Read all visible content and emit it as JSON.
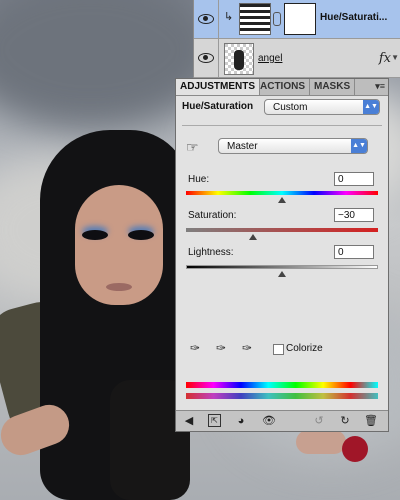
{
  "layers": {
    "rows": [
      {
        "name": "Hue/Saturati...",
        "type": "adjustment",
        "selected": true
      },
      {
        "name": "angel",
        "type": "pixel",
        "fx_label": "fx"
      }
    ]
  },
  "adjustments_panel": {
    "tabs": [
      {
        "label": "ADJUSTMENTS",
        "active": true
      },
      {
        "label": "ACTIONS",
        "active": false
      },
      {
        "label": "MASKS",
        "active": false
      }
    ],
    "title": "Hue/Saturation",
    "preset": "Custom",
    "channel": "Master",
    "hue": {
      "label": "Hue:",
      "value": "0",
      "slider_fraction": 0.5
    },
    "saturation": {
      "label": "Saturation:",
      "value": "−30",
      "slider_fraction": 0.35
    },
    "lightness": {
      "label": "Lightness:",
      "value": "0",
      "slider_fraction": 0.5
    },
    "colorize_label": "Colorize",
    "colorize_checked": false,
    "icons": [
      "eyedropper-icon",
      "eyedropper-plus-icon",
      "eyedropper-minus-icon"
    ],
    "bottom_icons": [
      "back-arrow-icon",
      "expand-icon",
      "clip-icon",
      "visibility-icon",
      "previous-state-icon",
      "reset-icon",
      "delete-icon"
    ]
  },
  "colors": {
    "panel_bg": "#e2e2e2",
    "selected_layer": "#a7c3ec",
    "accent": "#4a7fd6"
  }
}
